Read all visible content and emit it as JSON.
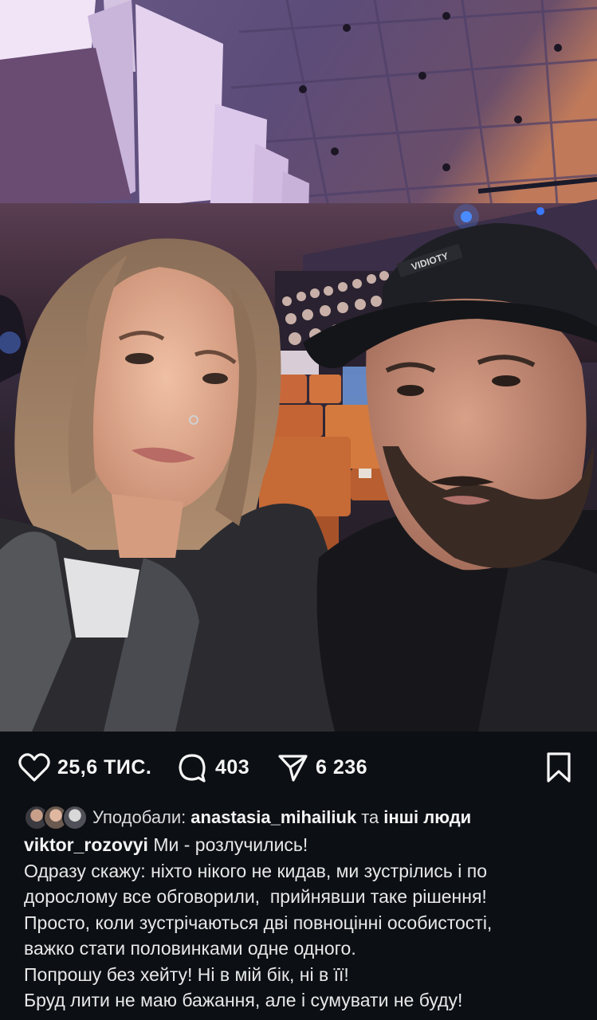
{
  "post": {
    "photo_alt": "Selfie of a woman and a bearded man in a cap in a concert hall",
    "cap_print": "VIDIOTY"
  },
  "actions": {
    "like_icon": "heart-icon",
    "likes": "25,6 ТИС.",
    "comment_icon": "comment-bubble-icon",
    "comments": "403",
    "share_icon": "paper-plane-icon",
    "shares": "6 236",
    "save_icon": "bookmark-icon"
  },
  "liked_by": {
    "prefix": "Уподобали:",
    "user": "anastasia_mihailiuk",
    "conjunction": "та",
    "others": "інші люди"
  },
  "caption": {
    "author": "viktor_rozovyi",
    "lines": [
      "Ми - розлучились!",
      "Одразу скажу: ніхто нікого не кидав, ми зустрілись і по",
      "дорослому все обговорили,  прийнявши таке рішення!",
      "Просто, коли зустрічаються дві повноцінні особистості,",
      "важко стати половинками одне одного.",
      "Попрошу без хейту! Ні в мій бік, ні в її!",
      "Бруд лити не маю бажання, але і сумувати не буду!"
    ]
  }
}
